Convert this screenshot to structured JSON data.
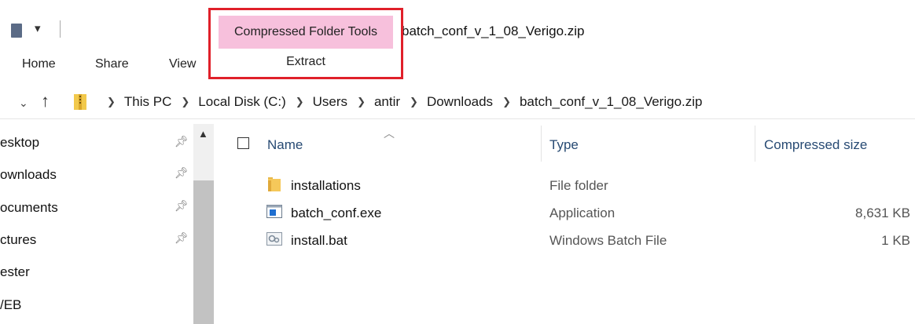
{
  "titlebar": {
    "quick_access_icon": "folder-quick-icon",
    "dropdown_glyph": "▾",
    "window_title": "batch_conf_v_1_08_Verigo.zip"
  },
  "ribbon": {
    "tabs": [
      {
        "label": "Home"
      },
      {
        "label": "Share"
      },
      {
        "label": "View"
      }
    ],
    "context_group": {
      "label": "Compressed Folder Tools",
      "tab": "Extract",
      "color": "#f7c0dc",
      "highlight_color": "#e0202a"
    }
  },
  "address": {
    "crumbs": [
      "This PC",
      "Local Disk (C:)",
      "Users",
      "antir",
      "Downloads",
      "batch_conf_v_1_08_Verigo.zip"
    ]
  },
  "nav_pane": {
    "items": [
      {
        "label": "esktop",
        "pinned": true
      },
      {
        "label": "ownloads",
        "pinned": true
      },
      {
        "label": "ocuments",
        "pinned": true
      },
      {
        "label": "ctures",
        "pinned": true
      },
      {
        "label": "ester",
        "pinned": false
      },
      {
        "label": "/EB",
        "pinned": false
      }
    ]
  },
  "columns": {
    "name": "Name",
    "type": "Type",
    "compressed_size": "Compressed size"
  },
  "files": [
    {
      "name": "installations",
      "type": "File folder",
      "size": "",
      "icon": "folder-icon"
    },
    {
      "name": "batch_conf.exe",
      "type": "Application",
      "size": "8,631 KB",
      "icon": "application-icon"
    },
    {
      "name": "install.bat",
      "type": "Windows Batch File",
      "size": "1 KB",
      "icon": "batch-file-icon"
    }
  ]
}
